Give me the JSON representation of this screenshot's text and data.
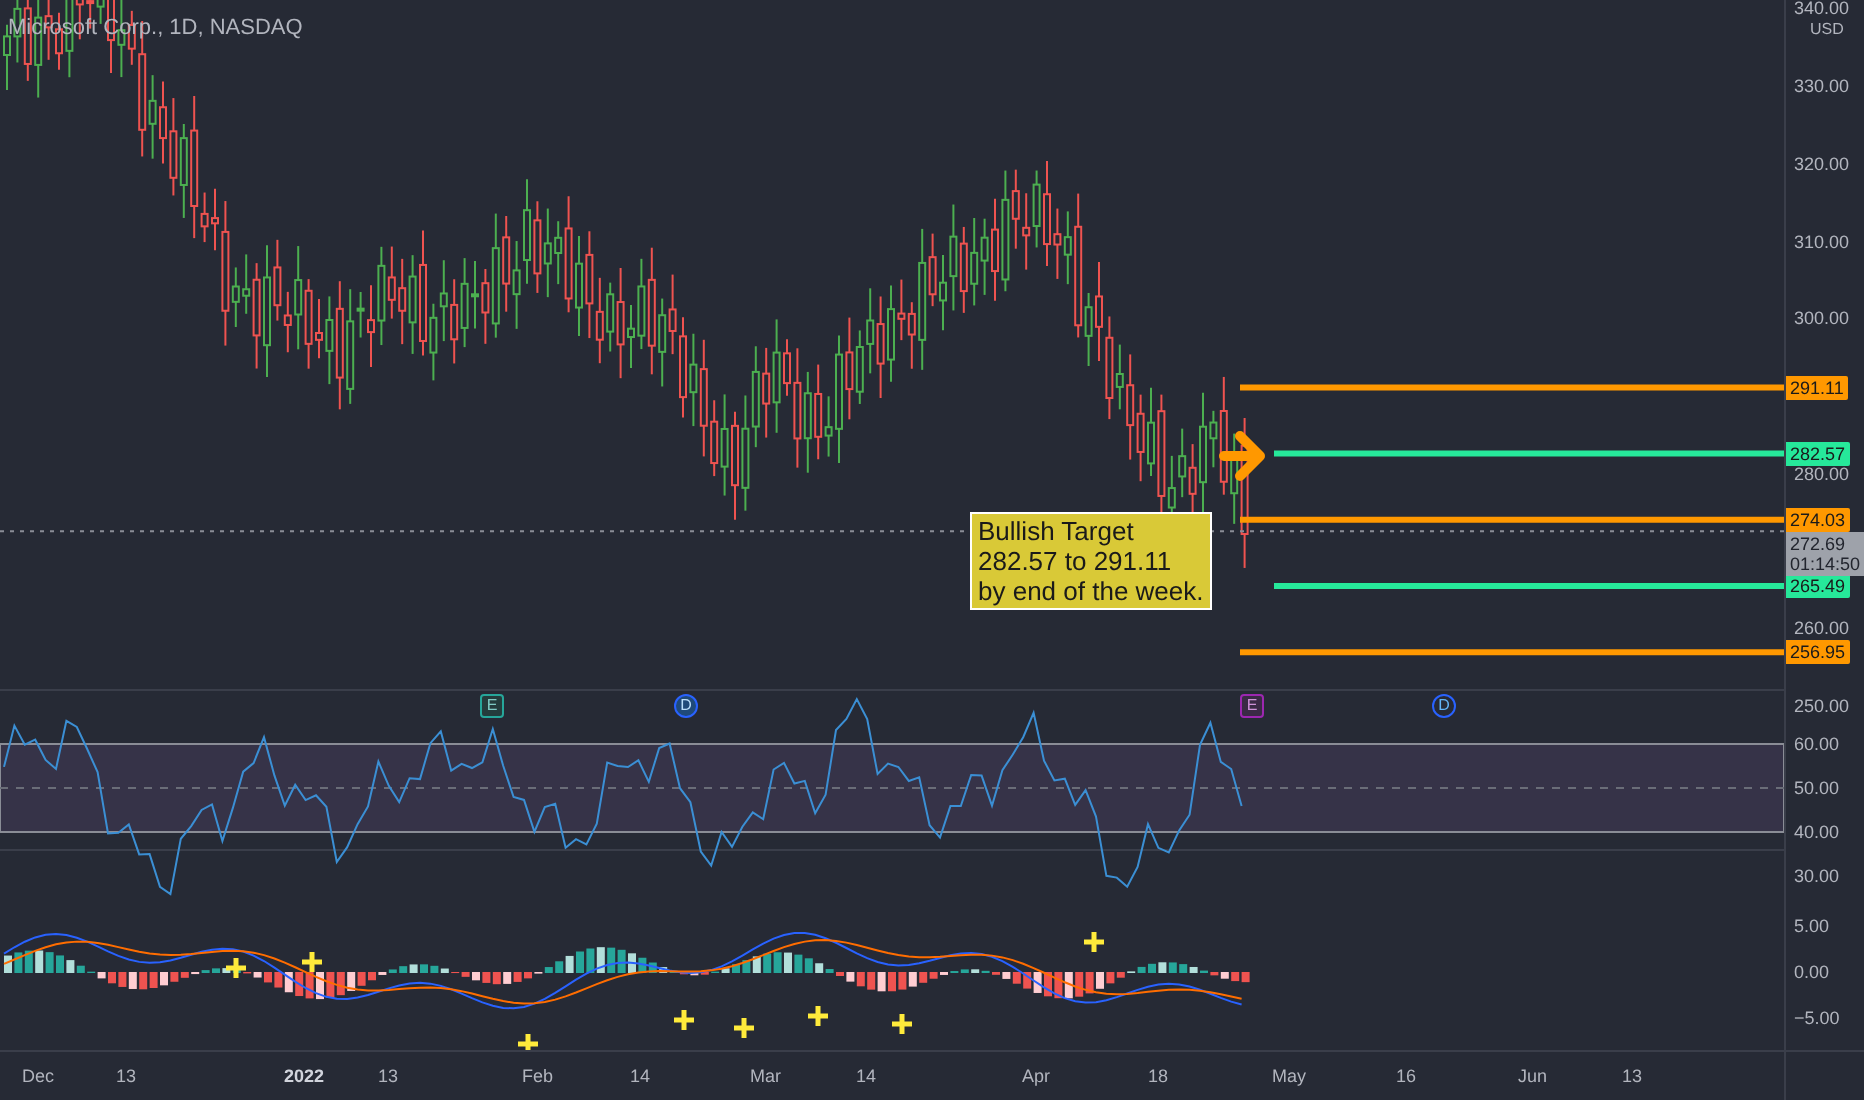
{
  "title": "Microsoft Corp., 1D, NASDAQ",
  "currency": "USD",
  "price_axis": [
    "340.00",
    "330.00",
    "320.00",
    "310.00",
    "300.00",
    "280.00",
    "260.00",
    "250.00"
  ],
  "price_lines": [
    {
      "value": "291.11",
      "color": "#ff9800",
      "kind": "target"
    },
    {
      "value": "282.57",
      "color": "#26e89a",
      "kind": "level"
    },
    {
      "value": "274.03",
      "color": "#ff9800",
      "kind": "target"
    },
    {
      "value": "265.49",
      "color": "#26e89a",
      "kind": "level"
    },
    {
      "value": "256.95",
      "color": "#ff9800",
      "kind": "target"
    }
  ],
  "last_price": {
    "value": "272.69",
    "countdown": "01:14:50"
  },
  "annotation": {
    "lines": [
      "Bullish Target",
      "282.57 to 291.11",
      "by end of the week."
    ]
  },
  "event_markers": [
    {
      "label": "E",
      "kind": "earnings",
      "upcoming": false
    },
    {
      "label": "D",
      "kind": "dividend",
      "upcoming": false
    },
    {
      "label": "E",
      "kind": "earnings",
      "upcoming": true
    },
    {
      "label": "D",
      "kind": "dividend",
      "upcoming": true
    }
  ],
  "rsi_axis": [
    "60.00",
    "50.00",
    "40.00",
    "30.00"
  ],
  "macd_axis": [
    "5.00",
    "0.00",
    "−5.00"
  ],
  "time_axis": [
    {
      "label": "Dec",
      "bold": false
    },
    {
      "label": "13",
      "bold": false
    },
    {
      "label": "2022",
      "bold": true
    },
    {
      "label": "13",
      "bold": false
    },
    {
      "label": "Feb",
      "bold": false
    },
    {
      "label": "14",
      "bold": false
    },
    {
      "label": "Mar",
      "bold": false
    },
    {
      "label": "14",
      "bold": false
    },
    {
      "label": "Apr",
      "bold": false
    },
    {
      "label": "18",
      "bold": false
    },
    {
      "label": "May",
      "bold": false
    },
    {
      "label": "16",
      "bold": false
    },
    {
      "label": "Jun",
      "bold": false
    },
    {
      "label": "13",
      "bold": false
    }
  ]
}
